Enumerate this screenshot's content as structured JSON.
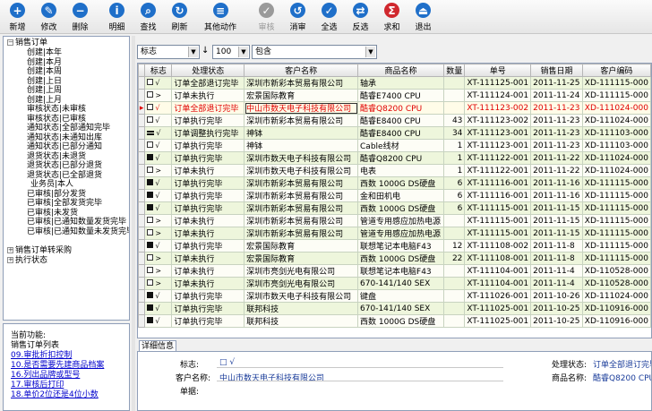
{
  "toolbar": {
    "buttons": [
      {
        "label": "新增",
        "icon": "plus-icon",
        "color": "#1f6fc9"
      },
      {
        "label": "修改",
        "icon": "edit-icon",
        "color": "#1f6fc9"
      },
      {
        "label": "删除",
        "icon": "minus-icon",
        "color": "#1f6fc9"
      },
      {
        "label": "明细",
        "icon": "info-icon",
        "color": "#1f6fc9"
      },
      {
        "label": "查找",
        "icon": "search-icon",
        "color": "#1f6fc9"
      },
      {
        "label": "刷新",
        "icon": "refresh-icon",
        "color": "#1f6fc9"
      },
      {
        "label": "其他动作",
        "icon": "actions-icon",
        "color": "#1f6fc9"
      },
      {
        "label": "审核",
        "icon": "approve-icon",
        "color": "#9a9a9a"
      },
      {
        "label": "消审",
        "icon": "unapprove-icon",
        "color": "#1f6fc9"
      },
      {
        "label": "全选",
        "icon": "select-all-icon",
        "color": "#1f6fc9"
      },
      {
        "label": "反选",
        "icon": "invert-select-icon",
        "color": "#1f6fc9"
      },
      {
        "label": "求和",
        "icon": "sum-icon",
        "color": "#d0282e"
      },
      {
        "label": "退出",
        "icon": "exit-icon",
        "color": "#1f6fc9"
      }
    ]
  },
  "tree": {
    "root1": "销售订单",
    "items": [
      "创建|本年",
      "创建|本月",
      "创建|本周",
      "创建|上日",
      "创建|上周",
      "创建|上月",
      "审核状态|未审核",
      "审核状态|已审核",
      "通知状态|全部通知完毕",
      "通知状态|未通知出库",
      "通知状态|已部分通知",
      "退货状态|未退货",
      "退货状态|已部分退货",
      "退货状态|已全部退货",
      "业务员|本人",
      "已审核|部分发货",
      "已审核|全部发货完毕",
      "已审核|未发货",
      "已审核|已通知数量发货完毕",
      "已审核|已通知数量未发货完毕"
    ],
    "root2": "销售订单转采购",
    "root3": "执行状态"
  },
  "functions": {
    "title": "当前功能:",
    "subtitle": "销售订单列表",
    "links": [
      "09.审批折扣控制",
      "10.是否需要先建商品档案",
      "16.列出品牌或型号",
      "17.审核后打印",
      "18.单价2位还是4位小数"
    ]
  },
  "filter": {
    "field": "标志",
    "count": "100",
    "op": "包含"
  },
  "grid": {
    "columns": [
      "标志",
      "处理状态",
      "客户名称",
      "商品名称",
      "数量",
      "单号",
      "销售日期",
      "客户编码"
    ],
    "rows": [
      {
        "flag": "empty",
        "mark": "√",
        "status": "订单全部退订完毕",
        "customer": "深圳市新彩本贸易有限公司",
        "product": "轴承",
        "qty": "",
        "no": "XT-111125-001",
        "date": "2011-11-25",
        "code": "XD-111115-000"
      },
      {
        "flag": "empty",
        "mark": ">",
        "status": "订单未执行",
        "customer": "宏景国际教育",
        "product": "酷睿E7400 CPU",
        "qty": "",
        "no": "XT-111124-001",
        "date": "2011-11-24",
        "code": "XD-111115-000"
      },
      {
        "flag": "empty",
        "mark": "√",
        "status": "订单全部退订完毕",
        "customer": "中山市数天电子科技有限公司",
        "product": "酷睿Q8200 CPU",
        "qty": "",
        "no": "XT-111123-002",
        "date": "2011-11-23",
        "code": "XD-111024-000"
      },
      {
        "flag": "empty",
        "mark": "√",
        "status": "订单执行完毕",
        "customer": "深圳市新彩本贸易有限公司",
        "product": "酷睿E8400 CPU",
        "qty": "43",
        "no": "XT-111123-002",
        "date": "2011-11-23",
        "code": "XD-111024-000"
      },
      {
        "flag": "eq",
        "mark": "√",
        "status": "订单调整执行完毕",
        "customer": "神钵",
        "product": "酷睿E8400 CPU",
        "qty": "34",
        "no": "XT-111123-001",
        "date": "2011-11-23",
        "code": "XD-111103-000"
      },
      {
        "flag": "empty",
        "mark": "√",
        "status": "订单执行完毕",
        "customer": "神钵",
        "product": "Cable线材",
        "qty": "1",
        "no": "XT-111123-001",
        "date": "2011-11-23",
        "code": "XD-111103-000"
      },
      {
        "flag": "solid",
        "mark": "√",
        "status": "订单执行完毕",
        "customer": "深圳市数天电子科技有限公司",
        "product": "酷睿Q8200 CPU",
        "qty": "1",
        "no": "XT-111122-001",
        "date": "2011-11-22",
        "code": "XD-111024-000"
      },
      {
        "flag": "empty",
        "mark": ">",
        "status": "订单未执行",
        "customer": "深圳市数天电子科技有限公司",
        "product": "电表",
        "qty": "1",
        "no": "XT-111122-001",
        "date": "2011-11-22",
        "code": "XD-111024-000"
      },
      {
        "flag": "solid",
        "mark": "√",
        "status": "订单执行完毕",
        "customer": "深圳市新彩本贸易有限公司",
        "product": "西数 1000G DS硬盘",
        "qty": "6",
        "no": "XT-111116-001",
        "date": "2011-11-16",
        "code": "XD-111115-000"
      },
      {
        "flag": "solid",
        "mark": "√",
        "status": "订单执行完毕",
        "customer": "深圳市新彩本贸易有限公司",
        "product": "金和田机电",
        "qty": "6",
        "no": "XT-111116-001",
        "date": "2011-11-16",
        "code": "XD-111115-000"
      },
      {
        "flag": "solid",
        "mark": "√",
        "status": "订单执行完毕",
        "customer": "深圳市新彩本贸易有限公司",
        "product": "西数 1000G DS硬盘",
        "qty": "6",
        "no": "XT-111115-001",
        "date": "2011-11-15",
        "code": "XD-111115-000"
      },
      {
        "flag": "empty",
        "mark": ">",
        "status": "订单未执行",
        "customer": "深圳市新彩本贸易有限公司",
        "product": "管道专用感应加热电源",
        "qty": "",
        "no": "XT-111115-001",
        "date": "2011-11-15",
        "code": "XD-111115-000"
      },
      {
        "flag": "empty",
        "mark": ">",
        "status": "订单未执行",
        "customer": "深圳市新彩本贸易有限公司",
        "product": "管道专用感应加热电源",
        "qty": "",
        "no": "XT-111115-001",
        "date": "2011-11-15",
        "code": "XD-111115-000"
      },
      {
        "flag": "solid",
        "mark": "√",
        "status": "订单执行完毕",
        "customer": "宏景国际教育",
        "product": "联想笔记本电脑F43",
        "qty": "12",
        "no": "XT-111108-002",
        "date": "2011-11-8",
        "code": "XD-111115-000"
      },
      {
        "flag": "empty",
        "mark": ">",
        "status": "订单未执行",
        "customer": "宏景国际教育",
        "product": "西数 1000G DS硬盘",
        "qty": "22",
        "no": "XT-111108-001",
        "date": "2011-11-8",
        "code": "XD-111115-000"
      },
      {
        "flag": "empty",
        "mark": ">",
        "status": "订单未执行",
        "customer": "深圳市亮剑光电有限公司",
        "product": "联想笔记本电脑F43",
        "qty": "",
        "no": "XT-111104-001",
        "date": "2011-11-4",
        "code": "XD-110528-000"
      },
      {
        "flag": "empty",
        "mark": ">",
        "status": "订单未执行",
        "customer": "深圳市亮剑光电有限公司",
        "product": "670-141/140 SEX",
        "qty": "",
        "no": "XT-111104-001",
        "date": "2011-11-4",
        "code": "XD-110528-000"
      },
      {
        "flag": "solid",
        "mark": "√",
        "status": "订单执行完毕",
        "customer": "深圳市数天电子科技有限公司",
        "product": "键盘",
        "qty": "",
        "no": "XT-111026-001",
        "date": "2011-10-26",
        "code": "XD-111024-000"
      },
      {
        "flag": "solid",
        "mark": "√",
        "status": "订单执行完毕",
        "customer": "联邦科技",
        "product": "670-141/140 SEX",
        "qty": "",
        "no": "XT-111025-001",
        "date": "2011-10-25",
        "code": "XD-110916-000"
      },
      {
        "flag": "solid",
        "mark": "√",
        "status": "订单执行完毕",
        "customer": "联邦科技",
        "product": "西数 1000G DS硬盘",
        "qty": "",
        "no": "XT-111025-001",
        "date": "2011-10-25",
        "code": "XD-110916-000"
      }
    ],
    "selected_row": 2
  },
  "detail": {
    "tab": "详细信息",
    "flag_label": "标志:",
    "flag_value": "□ √",
    "customer_label": "客户名称:",
    "customer_value": "中山市数天电子科技有限公司",
    "status_label": "处理状态:",
    "status_value": "订单全部退订完毕",
    "product_label": "商品名称:",
    "product_value": "酷睿Q8200 CPU",
    "cut_label": "单据:"
  }
}
